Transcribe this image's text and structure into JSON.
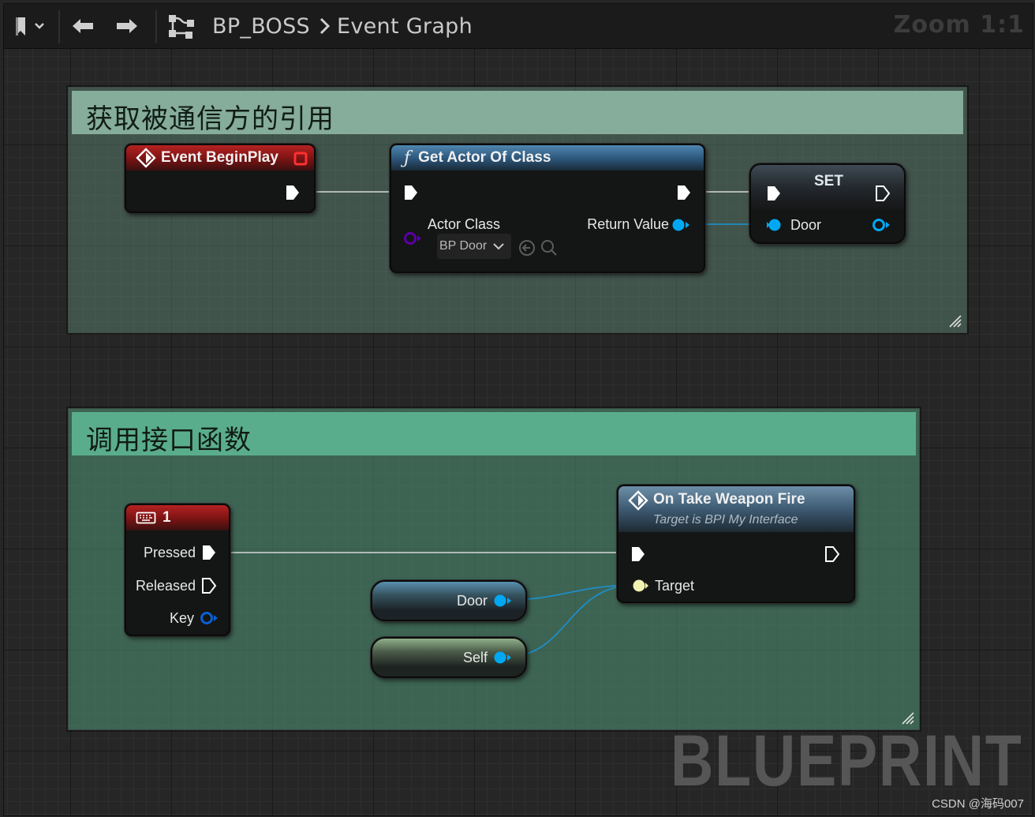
{
  "toolbar": {
    "breadcrumb_root": "BP_BOSS",
    "breadcrumb_sep": ">",
    "breadcrumb_current": "Event Graph",
    "zoom": "Zoom 1:1"
  },
  "comments": [
    {
      "title": "获取被通信方的引用",
      "color": "#86ac9c"
    },
    {
      "title": "调用接口函数",
      "color": "#5aad8c"
    }
  ],
  "nodes": {
    "begin_play": {
      "title": "Event BeginPlay"
    },
    "get_actor": {
      "title": "Get Actor Of Class",
      "func_icon": "ƒ",
      "actor_class_label": "Actor Class",
      "actor_class_value": "BP Door",
      "return_label": "Return Value"
    },
    "set": {
      "title": "SET",
      "door_label": "Door"
    },
    "key1": {
      "title": "1",
      "pressed": "Pressed",
      "released": "Released",
      "key": "Key"
    },
    "take_weapon": {
      "title": "On Take Weapon Fire",
      "subtitle": "Target is BPI My Interface",
      "target_label": "Target"
    },
    "door_var": {
      "label": "Door"
    },
    "self_var": {
      "label": "Self"
    }
  },
  "watermark": "BLUEPRINT",
  "credit": "CSDN @海码007",
  "colors": {
    "exec_pin": "#ffffff",
    "object_pin": "#00a8f3",
    "class_pin": "#5a00a8",
    "event_header": "#8d1a1a",
    "function_header": "#3b6a8f",
    "interface_target_pin": "#f2f2b0"
  },
  "icons": [
    "bookmark-icon",
    "chevron-down-icon",
    "arrow-left-icon",
    "arrow-right-icon",
    "graph-icon",
    "event-icon",
    "function-icon",
    "keyboard-icon",
    "reset-arrow-icon",
    "search-icon",
    "resize-grip-icon"
  ]
}
